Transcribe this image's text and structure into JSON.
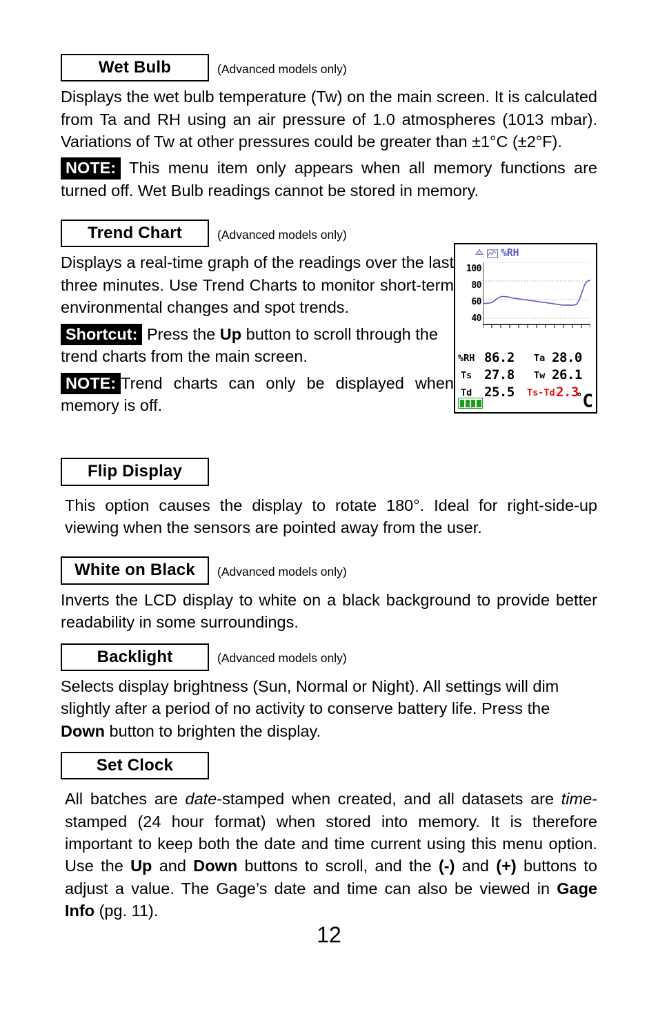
{
  "page_number": "12",
  "advanced_note": "(Advanced models only)",
  "sections": [
    {
      "title": "Wet Bulb",
      "advanced": "(Advanced models only)",
      "body": "Displays the wet bulb temperature (Tw) on the main screen. It is calculated from Ta and RH using an air pressure of 1.0 atmospheres (1013 mbar). Variations of Tw at other pressures could be greater than ±1°C (±2°F).",
      "note_tag": "NOTE:",
      "note_body": " This menu item only appears when all memory functions are turned off. Wet Bulb readings cannot be stored in memory."
    },
    {
      "title": "Trend Chart",
      "advanced": "(Advanced models only)",
      "body": "Displays a real-time graph of the readings over the last three minutes. Use Trend Charts to monitor short-term environmental changes and spot trends.",
      "shortcut_tag": "Shortcut:",
      "shortcut_pre": " Press the ",
      "shortcut_bold": "Up",
      "shortcut_post": " button to scroll through the trend charts from the main screen.",
      "note_tag": "NOTE:",
      "note_body": "Trend charts can only be displayed when memory is off."
    },
    {
      "title": "Flip Display",
      "body": "This option causes the display to rotate 180°. Ideal for right-side-up viewing when the sensors are pointed away from the user."
    },
    {
      "title": "White on Black",
      "advanced": "(Advanced models only)",
      "body": "Inverts the LCD display to white on a black background to provide better readability in some surroundings."
    },
    {
      "title": "Backlight",
      "advanced": "(Advanced models only)",
      "body_pre": "Selects display brightness (Sun, Normal or Night). All settings will dim slightly after a period of no activity to conserve battery life. Press the ",
      "body_bold": "Down",
      "body_post": " button to brighten the display."
    },
    {
      "title": "Set Clock",
      "clock_p1": "All batches are ",
      "clock_i1": "date",
      "clock_p2": "-stamped when created, and all datasets are ",
      "clock_i2": "time",
      "clock_p3": "-stamped (24 hour format) when stored into memory. It is therefore important to keep both the date and time current using this menu option. Use the ",
      "clock_b1": "Up",
      "clock_p4": " and ",
      "clock_b2": "Down",
      "clock_p5": " buttons to scroll, and the ",
      "clock_b3": "(-)",
      "clock_p6": " and ",
      "clock_b4": "(+)",
      "clock_p7": " buttons to adjust a value. The Gage’s date and time can also be viewed in ",
      "clock_b5": "Gage Info",
      "clock_p8": " (pg. 11)."
    }
  ],
  "lcd": {
    "title": "%RH",
    "y_labels": [
      "100",
      "80",
      "60",
      "40"
    ],
    "readings": [
      {
        "label": "%RH",
        "value": "86.2",
        "label2": "Ta",
        "value2": "28.0"
      },
      {
        "label": "Ts",
        "value": "27.8",
        "label2": "Tw",
        "value2": "26.1"
      },
      {
        "label": "Td",
        "value": "25.5",
        "label2": "Ts-Td",
        "value2": "2.3",
        "red": true
      }
    ],
    "unit": "°C",
    "battery_bars": 4,
    "accent_color": "#5b5fc0",
    "red_color": "#e01010",
    "battery_color": "#1aa01a"
  },
  "chart_data": {
    "type": "line",
    "title": "%RH",
    "ylabel": "",
    "xlabel": "",
    "ylim": [
      30,
      110
    ],
    "y_ticks": [
      40,
      60,
      80,
      100
    ],
    "grid": true,
    "series": [
      {
        "name": "%RH",
        "values": [
          57,
          57,
          57.5,
          58,
          60,
          63,
          65,
          66,
          66,
          65.5,
          65,
          64,
          63.5,
          63,
          62.5,
          62,
          61.5,
          61,
          60.5,
          60,
          59.5,
          59,
          58.5,
          58,
          57.5,
          57,
          56.5,
          56,
          55.5,
          55,
          55,
          55,
          55,
          55,
          56,
          62,
          72,
          82,
          86,
          87
        ]
      }
    ]
  }
}
